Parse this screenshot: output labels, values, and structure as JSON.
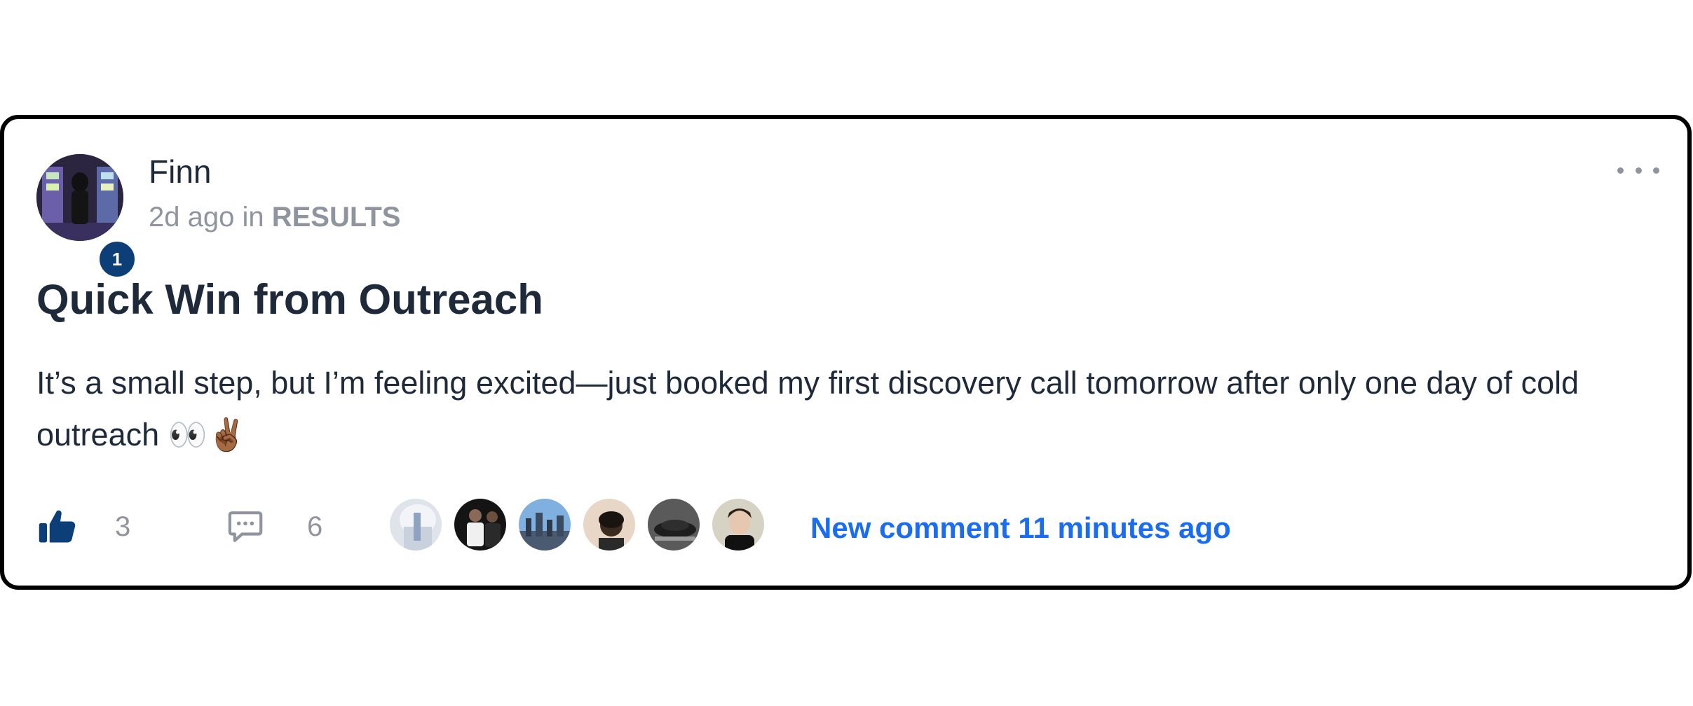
{
  "post": {
    "author": {
      "name": "Finn",
      "level": "1",
      "avatar_icon": "avatar-photo"
    },
    "meta": {
      "time_ago": "2d ago",
      "in_word": "in",
      "category": "RESULTS"
    },
    "title": "Quick Win from Outreach",
    "body": "It’s a small step, but I’m feeling excited—just booked my first discovery call tomorrow after only one day of cold outreach 👀✌🏾",
    "menu_icon": "more-horizontal-icon"
  },
  "footer": {
    "like_icon": "thumbs-up-icon",
    "like_count": "3",
    "comment_icon": "comment-bubble-icon",
    "comment_count": "6",
    "commenters": [
      {
        "name": "commenter-avatar-1"
      },
      {
        "name": "commenter-avatar-2"
      },
      {
        "name": "commenter-avatar-3"
      },
      {
        "name": "commenter-avatar-4"
      },
      {
        "name": "commenter-avatar-5"
      },
      {
        "name": "commenter-avatar-6"
      }
    ],
    "new_comment_text": "New comment 11 minutes ago"
  },
  "colors": {
    "card_border": "#000000",
    "text_primary": "#1e2a3a",
    "text_muted": "#8f959e",
    "link_blue": "#1a6cf0",
    "like_blue": "#0c3f78",
    "level_badge": "#0c3f78"
  }
}
